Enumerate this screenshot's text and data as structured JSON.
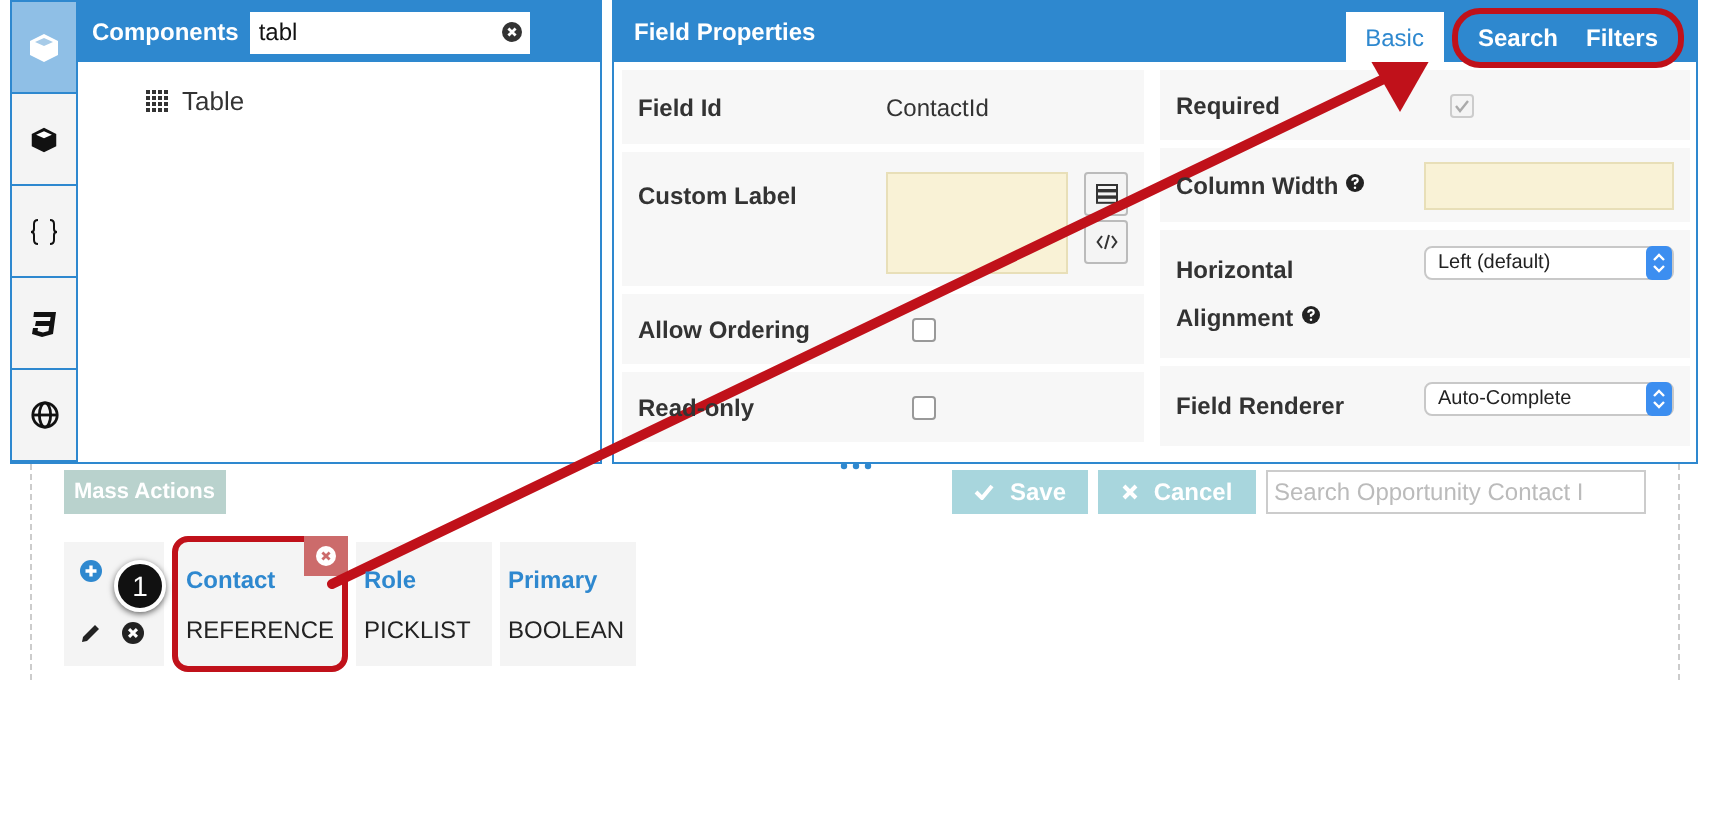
{
  "sidebar": {
    "items": [
      {
        "kind": "cube-outline",
        "selected": true
      },
      {
        "kind": "cube",
        "selected": false
      },
      {
        "kind": "braces",
        "selected": false
      },
      {
        "kind": "css",
        "selected": false
      },
      {
        "kind": "globe",
        "selected": false
      }
    ]
  },
  "components_panel": {
    "title": "Components",
    "search_value": "tabl",
    "items": [
      {
        "label": "Table"
      }
    ]
  },
  "field_properties": {
    "title": "Field Properties",
    "tabs": [
      {
        "label": "Basic",
        "selected": true
      },
      {
        "label": "Search",
        "selected": false
      },
      {
        "label": "Filters",
        "selected": false
      }
    ],
    "left_fields": [
      {
        "kind": "text",
        "label": "Field Id",
        "value": "ContactId"
      },
      {
        "kind": "textarea",
        "label": "Custom Label"
      },
      {
        "kind": "checkbox",
        "label": "Allow Ordering",
        "checked": false
      },
      {
        "kind": "checkbox",
        "label": "Read-only",
        "checked": false
      }
    ],
    "right_fields": [
      {
        "kind": "checkbox",
        "label": "Required",
        "checked": true
      },
      {
        "kind": "input",
        "label": "Column Width",
        "help": true
      },
      {
        "kind": "select",
        "label": "Horizontal Alignment",
        "help": true,
        "value": "Left (default)"
      },
      {
        "kind": "select",
        "label": "Field Renderer",
        "help": false,
        "value": "Auto-Complete"
      }
    ]
  },
  "toolbar": {
    "mass_actions": "Mass Actions",
    "save": "Save",
    "cancel": "Cancel",
    "search_placeholder": "Search Opportunity Contact I"
  },
  "table": {
    "columns": [
      {
        "label": "Contact",
        "highlighted": true
      },
      {
        "label": "Role",
        "highlighted": false
      },
      {
        "label": "Primary",
        "highlighted": false
      }
    ],
    "rows": [
      [
        "REFERENCE",
        "PICKLIST",
        "BOOLEAN"
      ]
    ]
  },
  "annotation": {
    "callout": "1"
  }
}
